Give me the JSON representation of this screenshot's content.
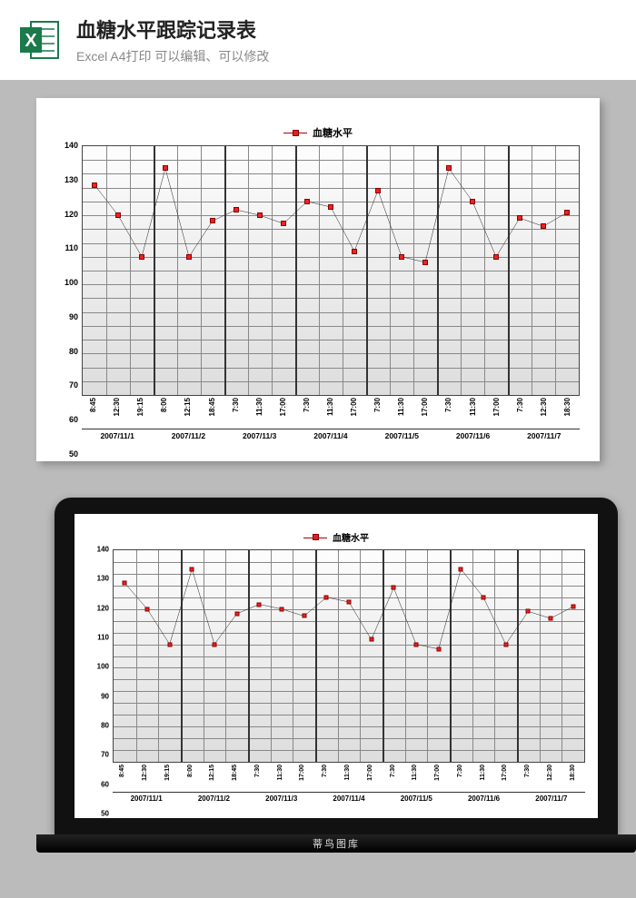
{
  "header": {
    "title": "血糖水平跟踪记录表",
    "subtitle": "Excel A4打印 可以编辑、可以修改",
    "icon_letter": "X"
  },
  "laptop_base_text": "蒂鸟图库",
  "chart_data": {
    "type": "line",
    "legend_label": "血糖水平",
    "ylim": [
      50,
      140
    ],
    "yticks": [
      50,
      60,
      70,
      80,
      90,
      100,
      110,
      120,
      130,
      140
    ],
    "groups": [
      {
        "label": "2007/11/1",
        "times": [
          "8:45",
          "12:30",
          "19:15"
        ],
        "values": [
          126,
          115,
          100
        ]
      },
      {
        "label": "2007/11/2",
        "times": [
          "8:00",
          "12:15",
          "18:45"
        ],
        "values": [
          132,
          100,
          113
        ]
      },
      {
        "label": "2007/11/3",
        "times": [
          "7:30",
          "11:30",
          "17:00"
        ],
        "values": [
          117,
          115,
          112
        ]
      },
      {
        "label": "2007/11/4",
        "times": [
          "7:30",
          "11:30",
          "17:00"
        ],
        "values": [
          120,
          118,
          102
        ]
      },
      {
        "label": "2007/11/5",
        "times": [
          "7:30",
          "11:30",
          "17:00"
        ],
        "values": [
          124,
          100,
          98
        ]
      },
      {
        "label": "2007/11/6",
        "times": [
          "7:30",
          "11:30",
          "17:00"
        ],
        "values": [
          132,
          120,
          100
        ]
      },
      {
        "label": "2007/11/7",
        "times": [
          "7:30",
          "12:30",
          "18:30"
        ],
        "values": [
          114,
          111,
          116
        ]
      }
    ]
  }
}
